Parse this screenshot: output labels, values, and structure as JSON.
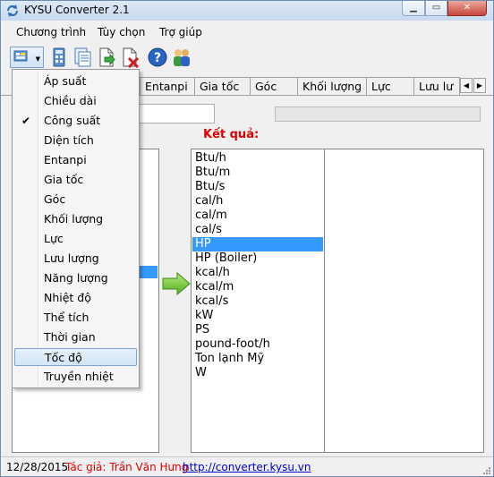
{
  "window": {
    "title": "KYSU Converter 2.1"
  },
  "menubar": {
    "items": [
      "Chương trình",
      "Tùy chọn",
      "Trợ giúp"
    ]
  },
  "tabs": [
    "Entanpi",
    "Gia tốc",
    "Góc",
    "Khối lượng",
    "Lực",
    "Lưu lư"
  ],
  "dropdown": {
    "checked_item": "Công suất",
    "hover_item": "Tốc độ",
    "items": [
      "Áp suất",
      "Chiều dài",
      "Công suất",
      "Diện tích",
      "Entanpi",
      "Gia tốc",
      "Góc",
      "Khối lượng",
      "Lực",
      "Lưu lượng",
      "Năng lượng",
      "Nhiệt độ",
      "Thể tích",
      "Thời gian",
      "Tốc độ",
      "Truyền nhiệt"
    ]
  },
  "result": {
    "label": "Kết quả:"
  },
  "units": {
    "selected": "HP",
    "items": [
      "Btu/h",
      "Btu/m",
      "Btu/s",
      "cal/h",
      "cal/m",
      "cal/s",
      "HP",
      "HP (Boiler)",
      "kcal/h",
      "kcal/m",
      "kcal/s",
      "kW",
      "PS",
      "pound-foot/h",
      "Ton lạnh Mỹ",
      "W"
    ]
  },
  "statusbar": {
    "date": "12/28/2015",
    "author": "Tác giả: Trần Văn Hưng",
    "link": "http://converter.kysu.vn"
  },
  "colors": {
    "accent": "#3399ff",
    "result_label": "#e00000",
    "link": "#0000cc"
  }
}
